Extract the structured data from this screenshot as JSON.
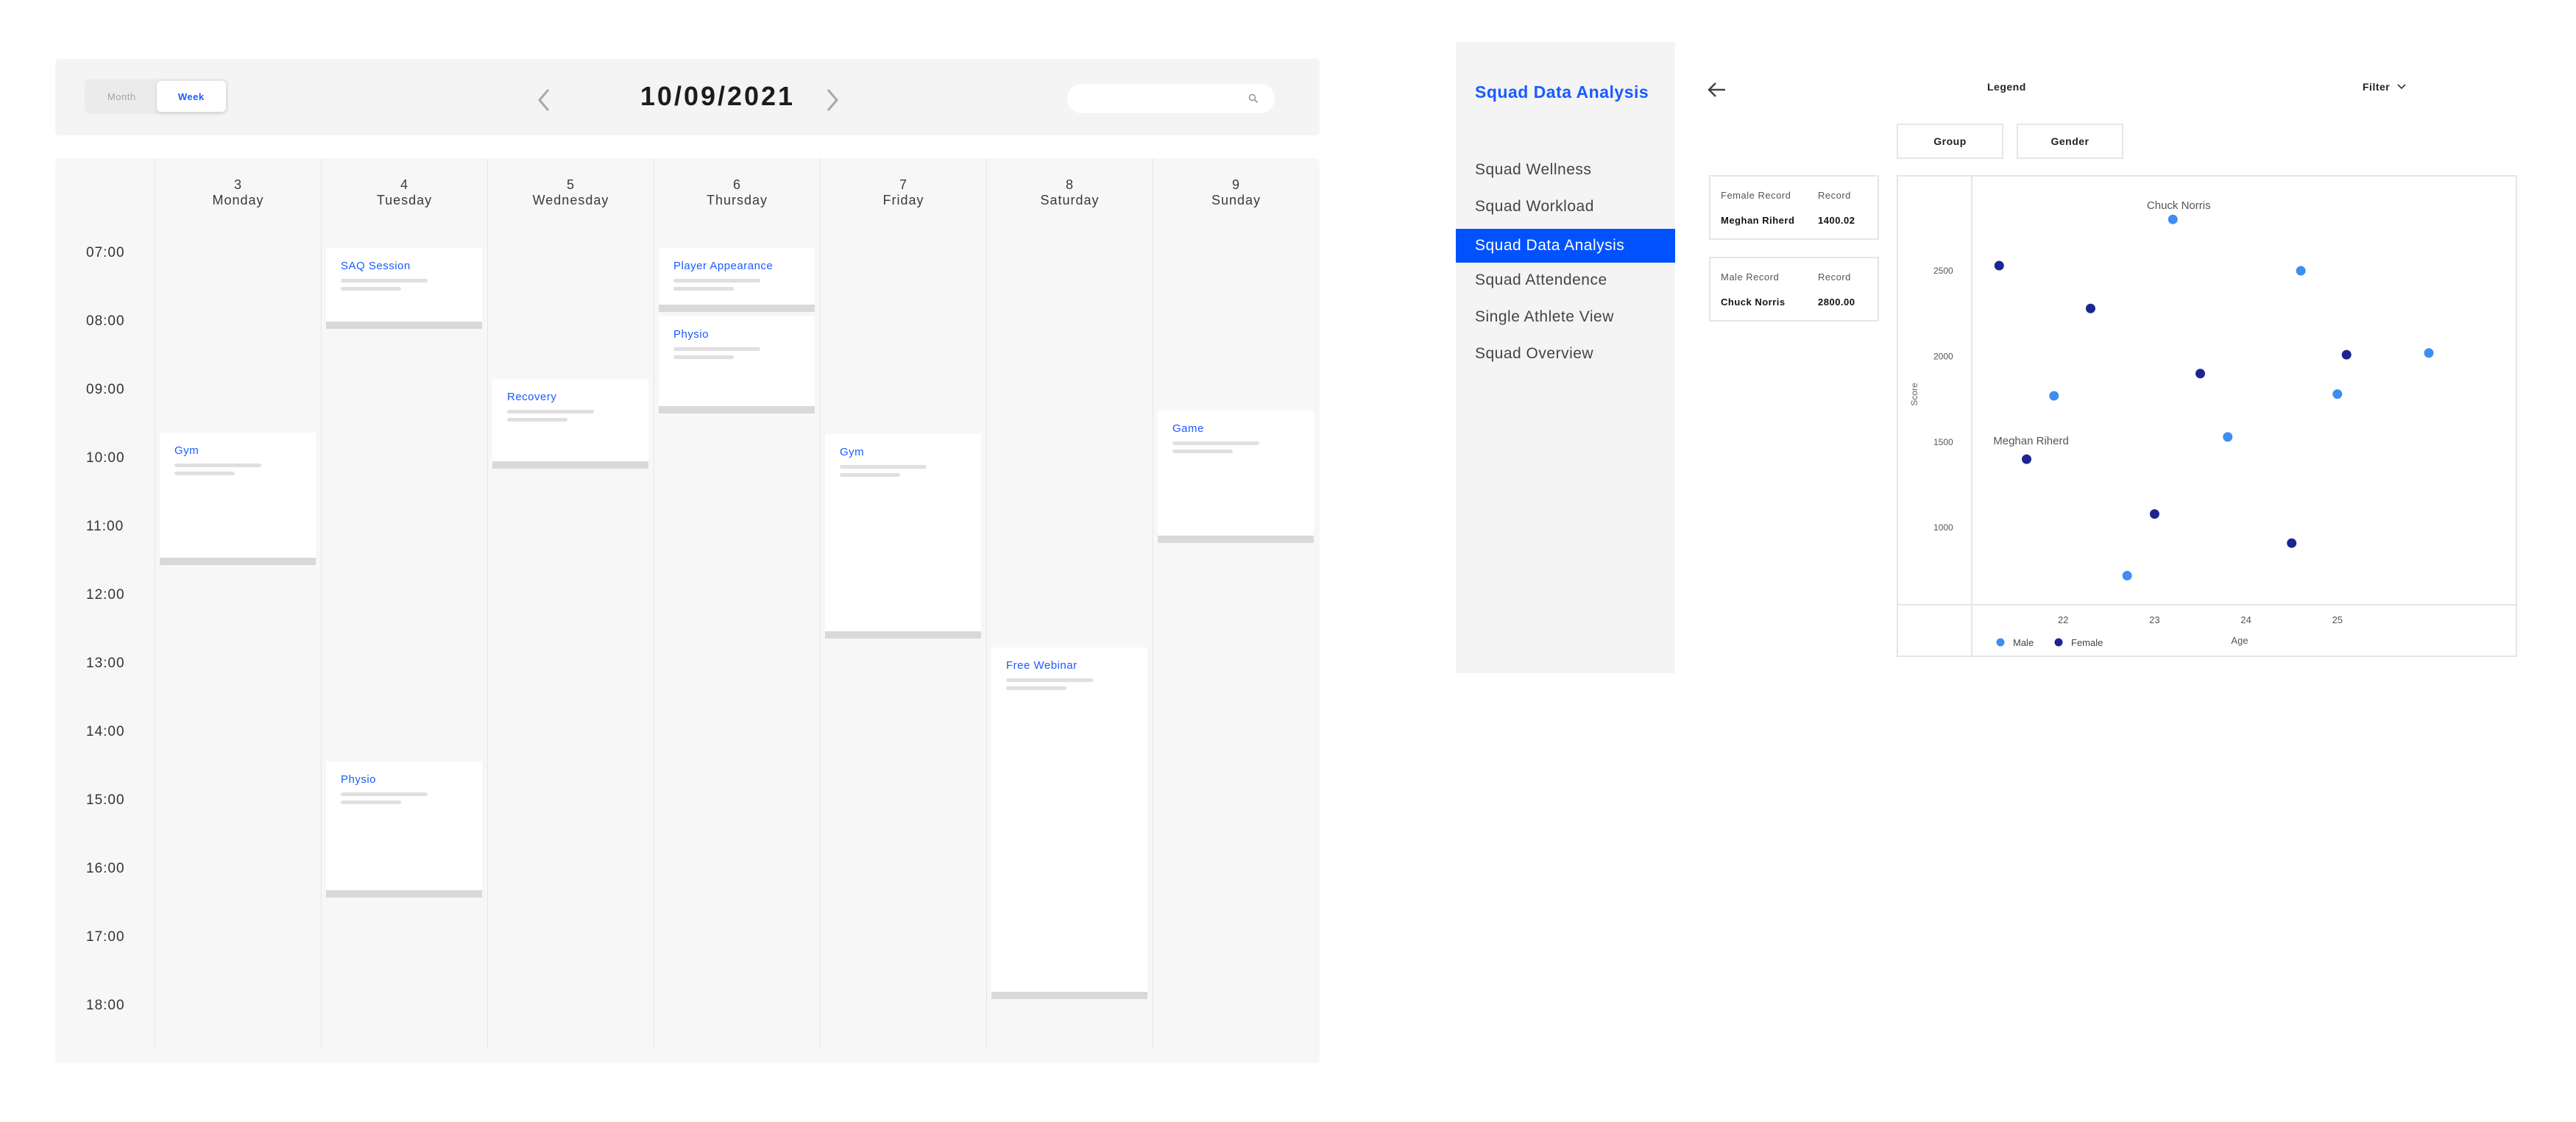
{
  "calendar": {
    "view_toggle": {
      "month": "Month",
      "week": "Week",
      "selected": "Week"
    },
    "date": "10/09/2021",
    "search": {
      "placeholder": ""
    },
    "days": [
      {
        "num": "3",
        "name": "Monday"
      },
      {
        "num": "4",
        "name": "Tuesday"
      },
      {
        "num": "5",
        "name": "Wednesday"
      },
      {
        "num": "6",
        "name": "Thursday"
      },
      {
        "num": "7",
        "name": "Friday"
      },
      {
        "num": "8",
        "name": "Saturday"
      },
      {
        "num": "9",
        "name": "Sunday"
      }
    ],
    "times": [
      "07:00",
      "08:00",
      "09:00",
      "10:00",
      "11:00",
      "12:00",
      "13:00",
      "14:00",
      "15:00",
      "16:00",
      "17:00",
      "18:00"
    ],
    "events": [
      {
        "day": "Monday",
        "title": "Gym"
      },
      {
        "day": "Tuesday",
        "title": "SAQ Session"
      },
      {
        "day": "Tuesday",
        "title": "Physio"
      },
      {
        "day": "Wednesday",
        "title": "Recovery"
      },
      {
        "day": "Thursday",
        "title": "Player Appearance"
      },
      {
        "day": "Thursday",
        "title": "Physio"
      },
      {
        "day": "Friday",
        "title": "Gym"
      },
      {
        "day": "Saturday",
        "title": "Free Webinar"
      },
      {
        "day": "Sunday",
        "title": "Game"
      }
    ]
  },
  "squad": {
    "title": "Squad Data Analysis",
    "menu": [
      {
        "label": "Squad Wellness"
      },
      {
        "label": "Squad Workload"
      },
      {
        "label": "Squad Data Analysis",
        "active": true
      },
      {
        "label": "Squad Attendence"
      },
      {
        "label": "Single Athlete View"
      },
      {
        "label": "Squad Overview"
      }
    ]
  },
  "analysis": {
    "legend_label": "Legend",
    "filter_label": "Filter",
    "group_button": "Group",
    "gender_button": "Gender",
    "records": [
      {
        "label": "Female Record",
        "record_label": "Record",
        "name": "Meghan Riherd",
        "value": "1400.02"
      },
      {
        "label": "Male Record",
        "record_label": "Record",
        "name": "Chuck Norris",
        "value": "2800.00"
      }
    ]
  },
  "chart_data": {
    "type": "scatter",
    "xlabel": "Age",
    "ylabel": "Score",
    "x_ticks": [
      22,
      23,
      24,
      25
    ],
    "y_ticks": [
      1000,
      1500,
      2000,
      2500
    ],
    "xlim": [
      21,
      26.95
    ],
    "ylim": [
      550,
      3050
    ],
    "legend_position": "bottom-left",
    "colors": {
      "Male": "#3d8ef0",
      "Female": "#1c2690"
    },
    "series": [
      {
        "name": "Male",
        "points": [
          [
            21.9,
            1770
          ],
          [
            22.7,
            720
          ],
          [
            23.2,
            2800
          ],
          [
            23.8,
            1530
          ],
          [
            24.6,
            2500
          ],
          [
            25.0,
            1780
          ],
          [
            26.0,
            2020
          ]
        ]
      },
      {
        "name": "Female",
        "points": [
          [
            21.3,
            2530
          ],
          [
            21.6,
            1400
          ],
          [
            22.3,
            2280
          ],
          [
            23.0,
            1080
          ],
          [
            23.5,
            1900
          ],
          [
            24.5,
            910
          ],
          [
            25.1,
            2010
          ]
        ]
      }
    ],
    "annotations": [
      {
        "text": "Chuck Norris",
        "x": 23.2,
        "y": 2800
      },
      {
        "text": "Meghan Riherd",
        "x": 21.6,
        "y": 1400
      }
    ]
  }
}
